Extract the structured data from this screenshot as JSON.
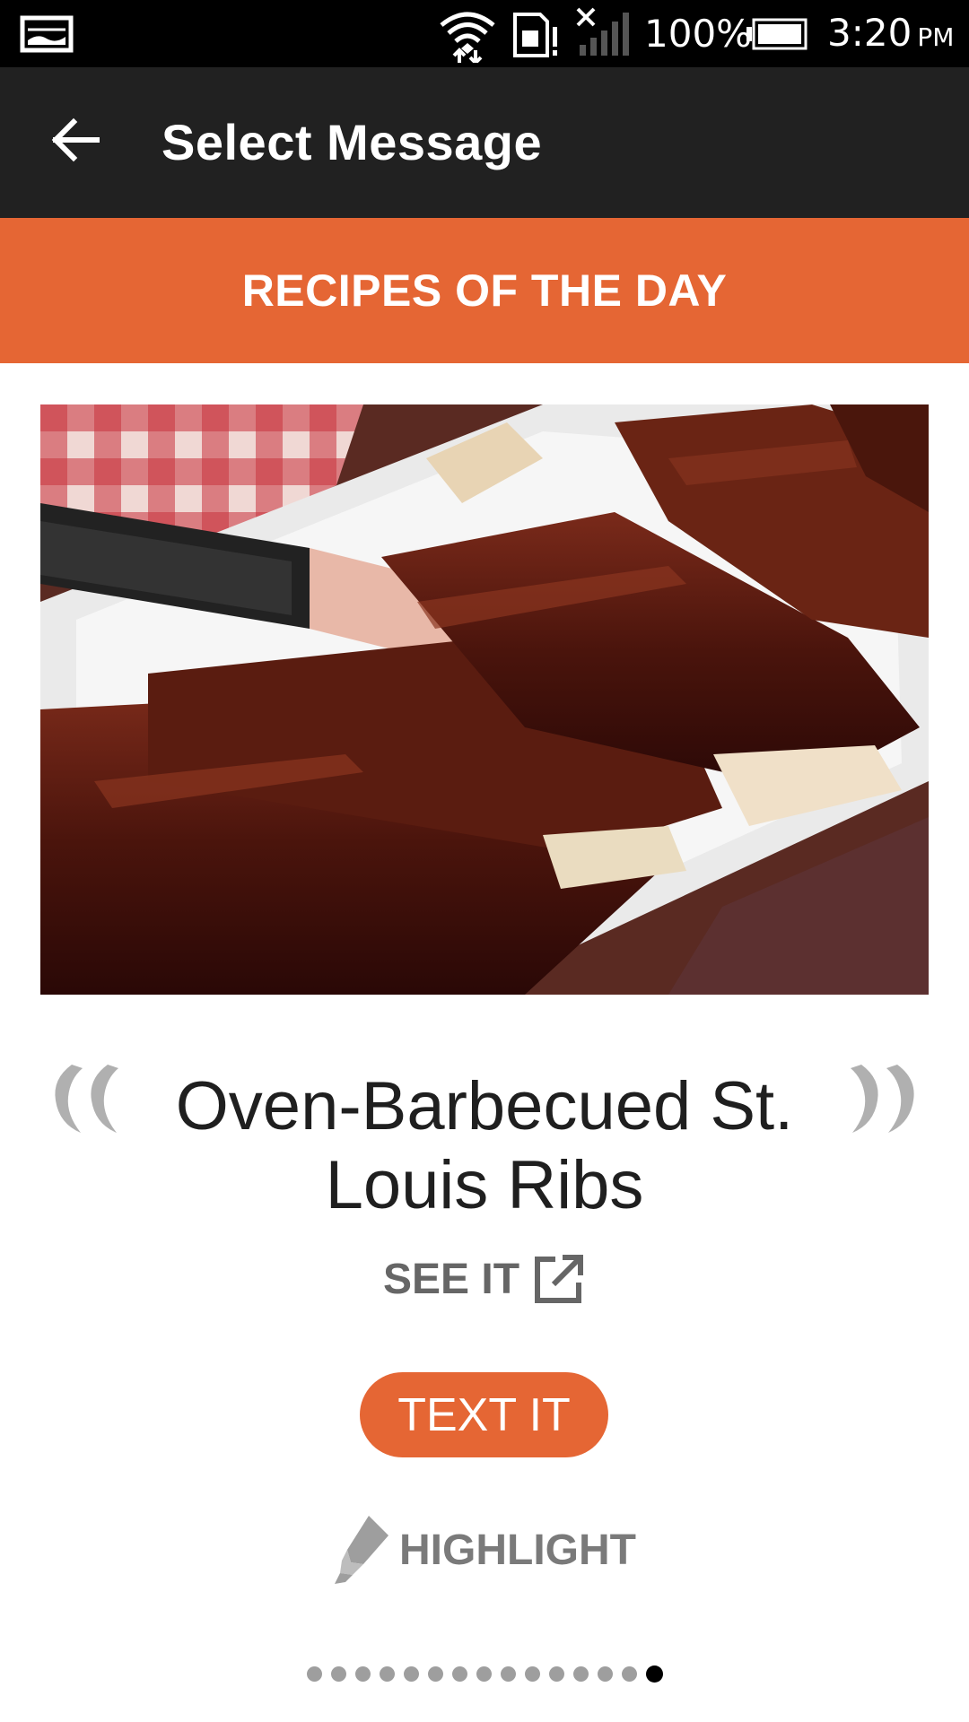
{
  "status_bar": {
    "battery_percent": "100%",
    "time": "3:20",
    "ampm": "PM",
    "icons": [
      "notification-image-icon",
      "wifi-icon",
      "sd-card-alert-icon",
      "signal-icon",
      "battery-icon"
    ]
  },
  "app_bar": {
    "title": "Select Message",
    "back_icon": "arrow-left-icon"
  },
  "banner": {
    "title": "RECIPES OF THE DAY",
    "color": "#e56634"
  },
  "recipe": {
    "title": "Oven-Barbecued St. Louis Ribs",
    "see_it_label": "SEE IT",
    "text_it_label": "TEXT IT",
    "highlight_label": "HIGHLIGHT"
  },
  "pagination": {
    "total": 15,
    "active_index": 14
  },
  "colors": {
    "accent": "#e56634",
    "app_bar": "#212121",
    "status_bar": "#000000"
  }
}
